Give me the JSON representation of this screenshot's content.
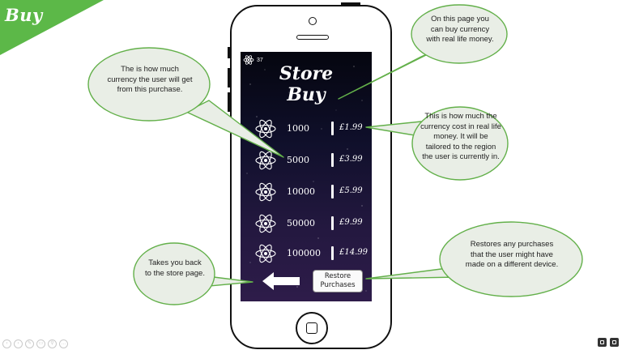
{
  "slide": {
    "title": "Buy",
    "accent_color": "#5cb848"
  },
  "app": {
    "title_line1": "Store",
    "title_line2": "Buy",
    "balance": "37",
    "items": [
      {
        "amount": "1000",
        "price": "£1.99"
      },
      {
        "amount": "5000",
        "price": "£3.99"
      },
      {
        "amount": "10000",
        "price": "£5.99"
      },
      {
        "amount": "50000",
        "price": "£9.99"
      },
      {
        "amount": "100000",
        "price": "£14.99"
      }
    ],
    "restore_line1": "Restore",
    "restore_line2": "Purchases",
    "icons": {
      "currency": "atom-icon",
      "back": "back-arrow-icon"
    }
  },
  "callouts": {
    "page_info": "On this page you can buy currency with real life money.",
    "currency_amount": "The is how much currency the user will get from this purchase.",
    "price_info": "This is how much the currency cost in real life money. It will be tailored to the region the user is currently in.",
    "back_info": "Takes you back to the store page.",
    "restore_info": "Restores any purchases that the user might have made on a different device.",
    "bubble_fill": "#e9eee6",
    "bubble_stroke": "#63b04a"
  }
}
